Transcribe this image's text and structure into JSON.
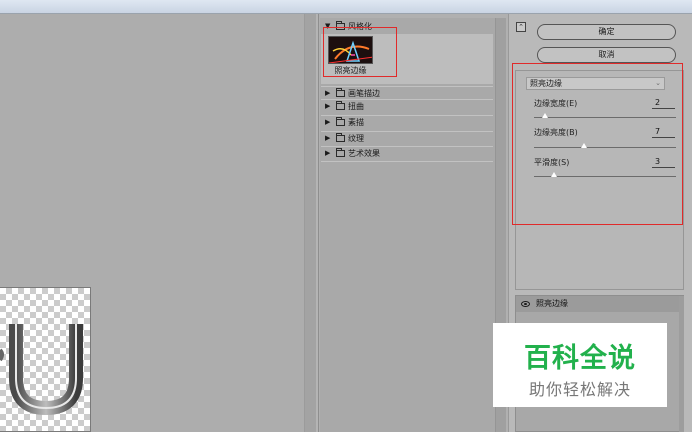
{
  "gallery": {
    "open_category": "风格化",
    "selected_filter": "照亮边缘",
    "categories": [
      "画笔描边",
      "扭曲",
      "素描",
      "纹理",
      "艺术效果"
    ]
  },
  "buttons": {
    "ok": "确定",
    "cancel": "取消",
    "collapse": "⌃"
  },
  "settings": {
    "filter_select": "照亮边缘",
    "params": [
      {
        "label": "边缘宽度(E)",
        "value": "2",
        "level": 0.08
      },
      {
        "label": "边缘亮度(B)",
        "value": "7",
        "level": 0.35
      },
      {
        "label": "平滑度(S)",
        "value": "3",
        "level": 0.14
      }
    ]
  },
  "layers": {
    "items": [
      "照亮边缘"
    ]
  },
  "watermark": {
    "title": "百科全说",
    "subtitle": "助你轻松解决"
  },
  "colors": {
    "highlight_box": "#e02a2a",
    "watermark_green": "#22b14c"
  }
}
